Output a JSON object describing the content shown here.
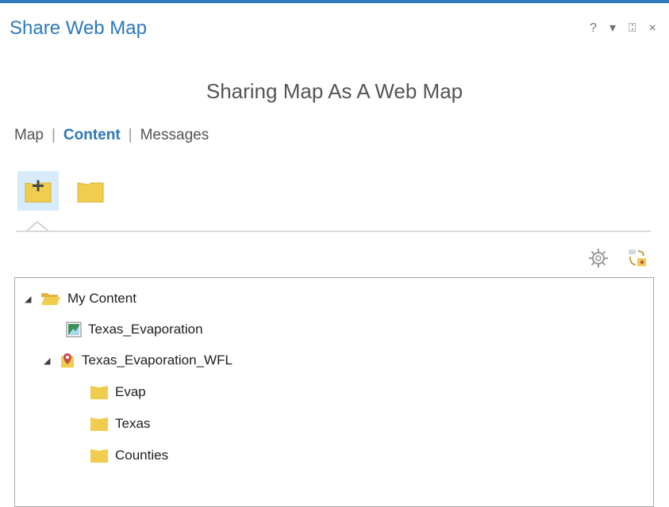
{
  "pane": {
    "title": "Share Web Map",
    "help_label": "?",
    "dropdown_label": "▾",
    "pin_label": "⍠",
    "close_label": "×"
  },
  "subtitle": "Sharing Map As A Web Map",
  "tabs": [
    {
      "label": "Map",
      "active": false
    },
    {
      "label": "Content",
      "active": true
    },
    {
      "label": "Messages",
      "active": false
    }
  ],
  "tab_separator": "|",
  "toolbar": {
    "buttons": [
      {
        "icon": "add-folder-icon",
        "selected": true
      },
      {
        "icon": "folder-icon",
        "selected": false
      }
    ]
  },
  "right_icons": [
    "gear-icon",
    "content-sync-icon"
  ],
  "tree": {
    "items": [
      {
        "label": "My Content",
        "icon": "open-folder-icon",
        "toggle": "◢"
      },
      {
        "label": "Texas_Evaporation",
        "icon": "web-map-icon",
        "toggle": ""
      },
      {
        "label": "Texas_Evaporation_WFL",
        "icon": "feature-layer-icon",
        "toggle": "◢"
      },
      {
        "label": "Evap",
        "icon": "folder-icon",
        "toggle": ""
      },
      {
        "label": "Texas",
        "icon": "folder-icon",
        "toggle": ""
      },
      {
        "label": "Counties",
        "icon": "folder-icon",
        "toggle": ""
      }
    ]
  },
  "colors": {
    "accent": "#2b78bd",
    "folder": "#f0cd4e",
    "selected_bg": "#d7ebfa"
  }
}
